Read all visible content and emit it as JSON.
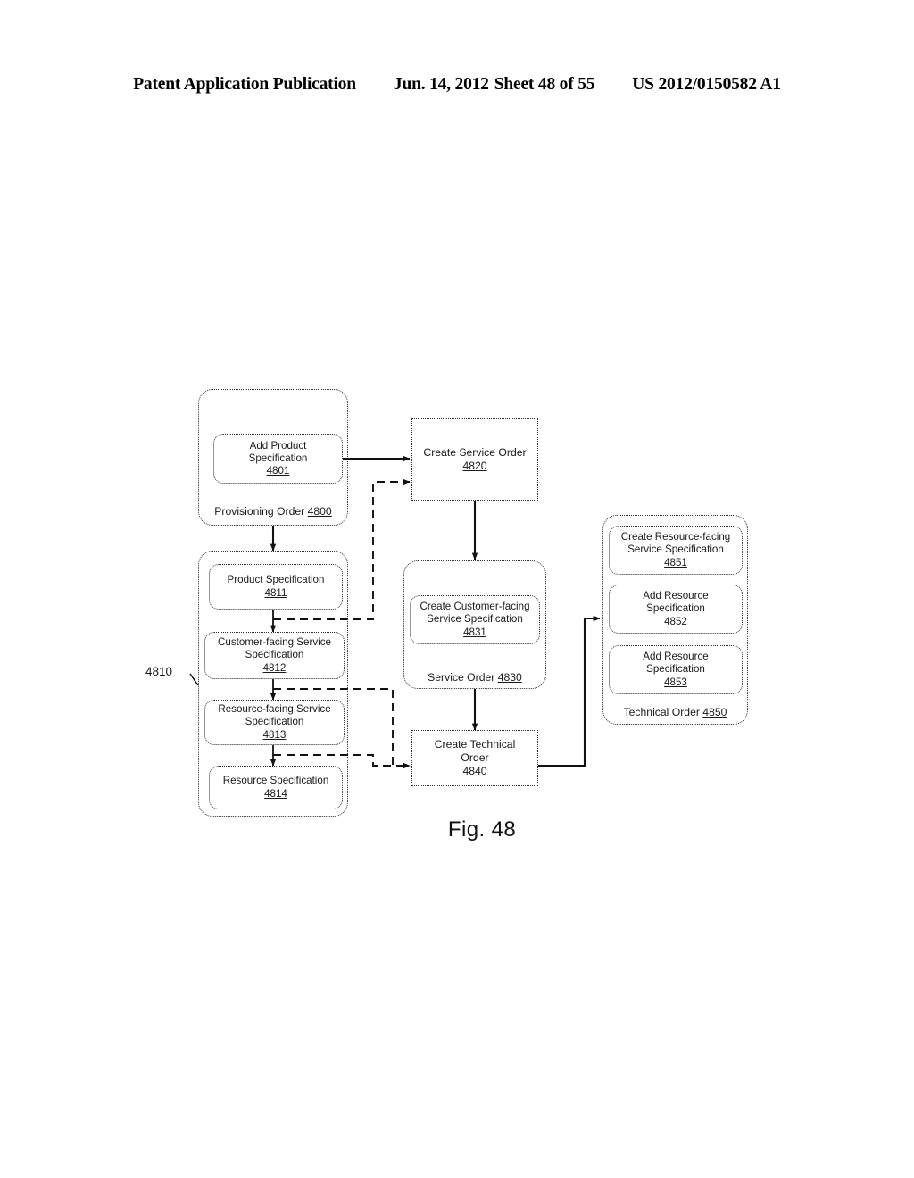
{
  "header": {
    "publication": "Patent Application Publication",
    "date": "Jun. 14, 2012",
    "sheet": "Sheet 48 of 55",
    "document_number": "US 2012/0150582 A1"
  },
  "figure": {
    "caption": "Fig. 48",
    "callouts": [
      {
        "id": "callout-4810",
        "ref": "4810"
      }
    ],
    "containers": [
      {
        "id": "provisioning-order",
        "caption_label": "Provisioning Order ",
        "caption_ref": "4800"
      },
      {
        "id": "specification-group",
        "caption_label": "",
        "caption_ref": ""
      },
      {
        "id": "service-order",
        "caption_label": "Service Order ",
        "caption_ref": "4830"
      },
      {
        "id": "technical-order",
        "caption_label": "Technical Order ",
        "caption_ref": "4850"
      }
    ],
    "nodes": [
      {
        "id": "add-product-specification",
        "label": "Add Product\nSpecification",
        "ref": "4801"
      },
      {
        "id": "create-service-order",
        "label": "Create Service Order",
        "ref": "4820"
      },
      {
        "id": "product-specification",
        "label": "Product Specification",
        "ref": "4811"
      },
      {
        "id": "customer-facing-service-specification",
        "label": "Customer-facing Service\nSpecification",
        "ref": "4812"
      },
      {
        "id": "resource-facing-service-specification",
        "label": "Resource-facing Service\nSpecification",
        "ref": "4813"
      },
      {
        "id": "resource-specification",
        "label": "Resource Specification",
        "ref": "4814"
      },
      {
        "id": "create-customer-facing-service-specification",
        "label": "Create Customer-facing\nService Specification",
        "ref": "4831"
      },
      {
        "id": "create-technical-order",
        "label": "Create Technical\nOrder",
        "ref": "4840"
      },
      {
        "id": "create-resource-facing-service-specification",
        "label": "Create Resource-facing\nService Specification",
        "ref": "4851"
      },
      {
        "id": "add-resource-specification-1",
        "label": "Add Resource\nSpecification",
        "ref": "4852"
      },
      {
        "id": "add-resource-specification-2",
        "label": "Add Resource\nSpecification",
        "ref": "4853"
      }
    ]
  }
}
